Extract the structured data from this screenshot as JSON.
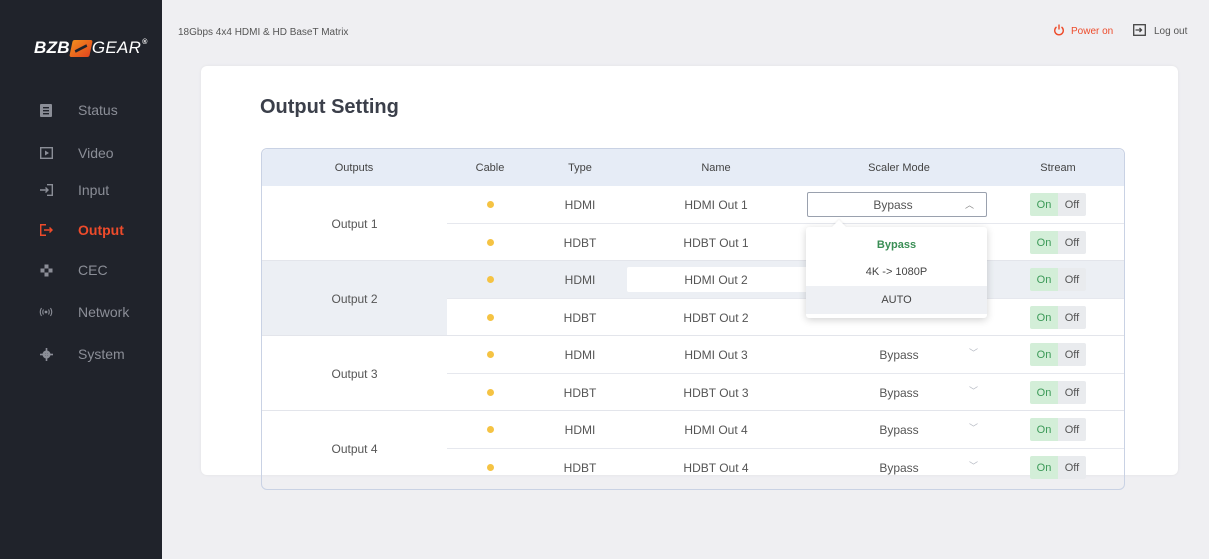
{
  "brand": {
    "bzb": "BZB",
    "gear": "GEAR",
    "reg": "®"
  },
  "sidebar": {
    "items": [
      {
        "label": "Status"
      },
      {
        "label": "Video"
      },
      {
        "label": "Input"
      },
      {
        "label": "Output"
      },
      {
        "label": "CEC"
      },
      {
        "label": "Network"
      },
      {
        "label": "System"
      }
    ]
  },
  "header": {
    "title": "18Gbps 4x4 HDMI & HD BaseT Matrix",
    "power": "Power on",
    "logout": "Log out"
  },
  "colors": {
    "accent": "#ee4b2b",
    "sidebar": "#20232b",
    "cable_dot": "#f5c343",
    "on_green": "#3c9a58"
  },
  "page": {
    "title": "Output Setting"
  },
  "table": {
    "headers": [
      "Outputs",
      "Cable",
      "Type",
      "Name",
      "Scaler Mode",
      "Stream"
    ],
    "groups": [
      {
        "output": "Output 1",
        "rows": [
          {
            "type": "HDMI",
            "name": "HDMI Out 1",
            "scaler": "Bypass",
            "on": "On",
            "off": "Off"
          },
          {
            "type": "HDBT",
            "name": "HDBT Out 1",
            "scaler": "",
            "on": "On",
            "off": "Off"
          }
        ]
      },
      {
        "output": "Output 2",
        "rows": [
          {
            "type": "HDMI",
            "name": "HDMI Out 2",
            "scaler": "",
            "on": "On",
            "off": "Off"
          },
          {
            "type": "HDBT",
            "name": "HDBT Out 2",
            "scaler": "",
            "on": "On",
            "off": "Off"
          }
        ]
      },
      {
        "output": "Output 3",
        "rows": [
          {
            "type": "HDMI",
            "name": "HDMI Out 3",
            "scaler": "Bypass",
            "on": "On",
            "off": "Off"
          },
          {
            "type": "HDBT",
            "name": "HDBT Out 3",
            "scaler": "Bypass",
            "on": "On",
            "off": "Off"
          }
        ]
      },
      {
        "output": "Output 4",
        "rows": [
          {
            "type": "HDMI",
            "name": "HDMI Out 4",
            "scaler": "Bypass",
            "on": "On",
            "off": "Off"
          },
          {
            "type": "HDBT",
            "name": "HDBT Out 4",
            "scaler": "Bypass",
            "on": "On",
            "off": "Off"
          }
        ]
      }
    ]
  },
  "dropdown": {
    "options": [
      "Bypass",
      "4K -> 1080P",
      "AUTO"
    ],
    "selected": "Bypass"
  }
}
